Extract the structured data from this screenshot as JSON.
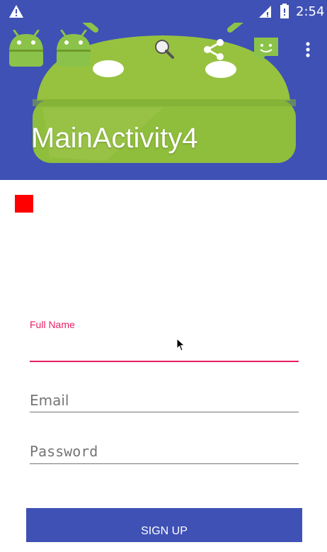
{
  "status_bar": {
    "time": "2:54",
    "icons": [
      "warning-icon",
      "signal-icon",
      "battery-icon"
    ]
  },
  "app_bar": {
    "title": "MainActivity4",
    "background": "#3f51b5",
    "icons": [
      "android-icon",
      "android-icon",
      "search-icon",
      "share-icon",
      "chat-icon",
      "overflow-menu-icon"
    ]
  },
  "form": {
    "full_name_label": "Full Name",
    "full_name_value": "",
    "email_placeholder": "Email",
    "password_placeholder": "Password",
    "signup_label": "SIGN UP"
  },
  "colors": {
    "primary": "#3f51b5",
    "accent": "#e91e63",
    "red_square": "#ff0000"
  }
}
